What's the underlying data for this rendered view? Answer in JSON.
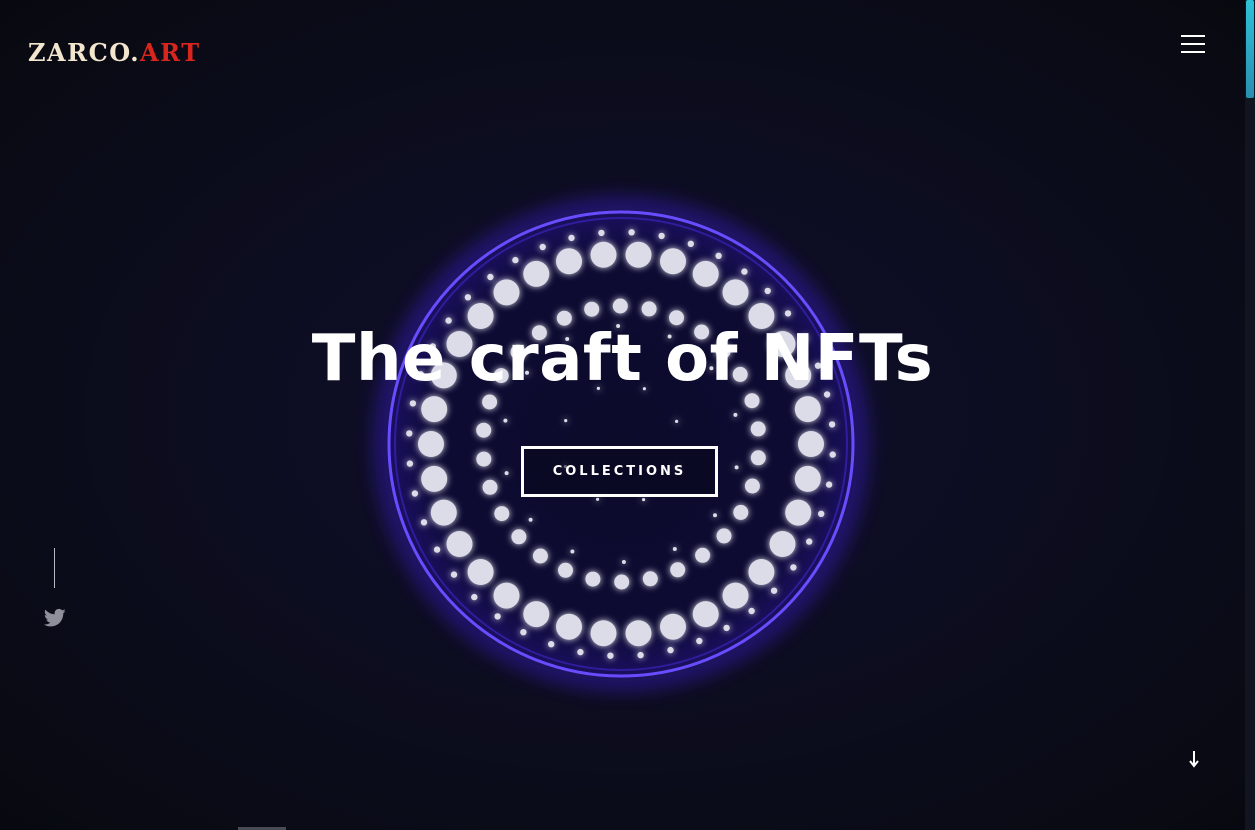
{
  "header": {
    "logo_main": "ZARCO.",
    "logo_accent": "ART",
    "menu_icon": "hamburger-menu-icon"
  },
  "hero": {
    "title": "The craft of NFTs",
    "cta_label": "COLLECTIONS"
  },
  "social": {
    "items": [
      {
        "name": "twitter",
        "icon": "twitter-bird-icon"
      }
    ]
  },
  "scroll_indicator": {
    "icon": "arrow-down-icon"
  },
  "colors": {
    "background": "#0b0c18",
    "logo_text": "#f2e6cf",
    "logo_accent": "#d8261e",
    "ring": "#5b3cff",
    "text": "#ffffff"
  }
}
